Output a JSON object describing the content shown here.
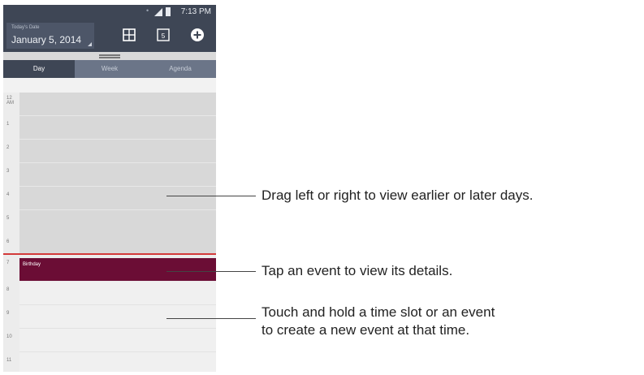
{
  "status_bar": {
    "time": "7:13 PM"
  },
  "app_bar": {
    "date_small": "Today's Date",
    "date": "January 5, 2014",
    "grid_icon": "grid-view-icon",
    "day_icon": "today-icon",
    "day_icon_number": "5",
    "add_icon": "add-event-icon"
  },
  "tabs": [
    {
      "label": "Day",
      "active": true
    },
    {
      "label": "Week",
      "active": false
    },
    {
      "label": "Agenda",
      "active": false
    }
  ],
  "hours": [
    {
      "label": "12",
      "sub": "AM"
    },
    {
      "label": "1"
    },
    {
      "label": "2"
    },
    {
      "label": "3"
    },
    {
      "label": "4"
    },
    {
      "label": "5"
    },
    {
      "label": "6"
    },
    {
      "label": "7"
    },
    {
      "label": "8"
    },
    {
      "label": "9"
    },
    {
      "label": "10"
    },
    {
      "label": "11"
    }
  ],
  "event": {
    "title": "Birthday",
    "color": "#6b0d35"
  },
  "callouts": {
    "drag": "Drag left or right to view earlier or later days.",
    "tap": "Tap an event to view its details.",
    "hold_line1": "Touch and hold a time slot or an event",
    "hold_line2": "to create a new event at that time."
  },
  "colors": {
    "app_bar": "#3e4655",
    "tab_bar": "#6b7588",
    "now_line": "#d33a3a"
  }
}
